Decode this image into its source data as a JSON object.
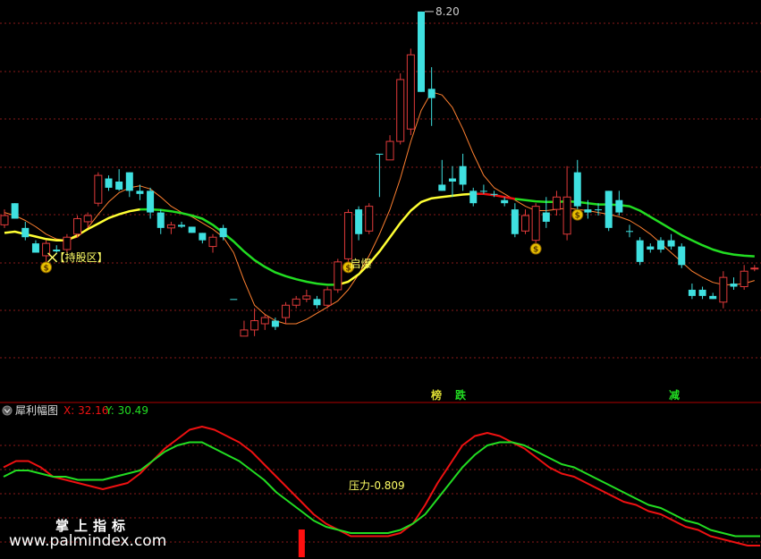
{
  "colors": {
    "background": "#000000",
    "grid": "#8a1a1a",
    "separator": "#b00000",
    "up_candle": "#e03a3a",
    "down_candle": "#3fe0e0",
    "ma_thin": "#ff8030",
    "ma_yellow": "#ffff33",
    "ma_green": "#22dd22",
    "ma_red": "#ee1111",
    "osc_red": "#ee1111",
    "osc_green": "#22dd22",
    "label_yellow": "#ffff66",
    "signal_gold": "#e8c000",
    "watermark": "#ffffff"
  },
  "main_chart": {
    "max_price_label": "8.20",
    "signal_labels": {
      "hold_zone": "【持股区】",
      "burst": "启爆",
      "top": "榜",
      "fall": "跌",
      "reduce": "减"
    },
    "money_icon_glyph": "$"
  },
  "sub_chart": {
    "indicator_name": "犀利幅图",
    "x_readout": "X: 32.16",
    "y_readout": "Y: 30.49",
    "pressure_label": "压力-0.809"
  },
  "watermark": {
    "cn": "掌上指标",
    "url": "www.palmindex.com"
  },
  "chart_data": [
    {
      "type": "candlestick",
      "title": "",
      "xlabel": "",
      "ylabel": "",
      "ylim": [
        2.6,
        8.3
      ],
      "grid": true,
      "max_label_value": 8.2,
      "candles": [
        {
          "o": 4.9,
          "h": 5.0,
          "l": 4.7,
          "c": 4.75,
          "dir": "up"
        },
        {
          "o": 5.1,
          "h": 5.1,
          "l": 4.85,
          "c": 4.85,
          "dir": "down"
        },
        {
          "o": 4.7,
          "h": 4.8,
          "l": 4.5,
          "c": 4.55,
          "dir": "down"
        },
        {
          "o": 4.45,
          "h": 4.5,
          "l": 4.3,
          "c": 4.3,
          "dir": "down"
        },
        {
          "o": 4.25,
          "h": 4.5,
          "l": 4.15,
          "c": 4.45,
          "dir": "up"
        },
        {
          "o": 4.35,
          "h": 4.42,
          "l": 4.3,
          "c": 4.32,
          "dir": "down"
        },
        {
          "o": 4.35,
          "h": 4.6,
          "l": 4.3,
          "c": 4.55,
          "dir": "up"
        },
        {
          "o": 4.6,
          "h": 4.9,
          "l": 4.55,
          "c": 4.85,
          "dir": "up"
        },
        {
          "o": 4.8,
          "h": 4.95,
          "l": 4.7,
          "c": 4.9,
          "dir": "up"
        },
        {
          "o": 5.1,
          "h": 5.6,
          "l": 5.05,
          "c": 5.55,
          "dir": "up"
        },
        {
          "o": 5.5,
          "h": 5.55,
          "l": 5.3,
          "c": 5.35,
          "dir": "down"
        },
        {
          "o": 5.45,
          "h": 5.65,
          "l": 5.3,
          "c": 5.32,
          "dir": "down"
        },
        {
          "o": 5.6,
          "h": 5.6,
          "l": 5.2,
          "c": 5.3,
          "dir": "down"
        },
        {
          "o": 5.3,
          "h": 5.4,
          "l": 5.15,
          "c": 5.25,
          "dir": "down"
        },
        {
          "o": 5.3,
          "h": 5.35,
          "l": 4.85,
          "c": 4.95,
          "dir": "down"
        },
        {
          "o": 4.95,
          "h": 5.0,
          "l": 4.6,
          "c": 4.7,
          "dir": "down"
        },
        {
          "o": 4.7,
          "h": 4.8,
          "l": 4.6,
          "c": 4.75,
          "dir": "up"
        },
        {
          "o": 4.75,
          "h": 4.8,
          "l": 4.7,
          "c": 4.72,
          "dir": "down"
        },
        {
          "o": 4.72,
          "h": 4.72,
          "l": 4.62,
          "c": 4.62,
          "dir": "down"
        },
        {
          "o": 4.62,
          "h": 4.62,
          "l": 4.45,
          "c": 4.5,
          "dir": "down"
        },
        {
          "o": 4.4,
          "h": 4.6,
          "l": 4.3,
          "c": 4.55,
          "dir": "up"
        },
        {
          "o": 4.7,
          "h": 4.75,
          "l": 4.5,
          "c": 4.55,
          "dir": "down"
        },
        {
          "o": 3.55,
          "h": 3.55,
          "l": 3.55,
          "c": 3.55,
          "dir": "down"
        },
        {
          "o": 2.95,
          "h": 3.2,
          "l": 2.95,
          "c": 3.05,
          "dir": "up"
        },
        {
          "o": 3.05,
          "h": 3.4,
          "l": 2.95,
          "c": 3.2,
          "dir": "up"
        },
        {
          "o": 3.15,
          "h": 3.3,
          "l": 3.05,
          "c": 3.25,
          "dir": "up"
        },
        {
          "o": 3.2,
          "h": 3.25,
          "l": 3.05,
          "c": 3.1,
          "dir": "down"
        },
        {
          "o": 3.25,
          "h": 3.5,
          "l": 3.15,
          "c": 3.45,
          "dir": "up"
        },
        {
          "o": 3.45,
          "h": 3.6,
          "l": 3.4,
          "c": 3.55,
          "dir": "up"
        },
        {
          "o": 3.55,
          "h": 3.7,
          "l": 3.5,
          "c": 3.6,
          "dir": "up"
        },
        {
          "o": 3.55,
          "h": 3.6,
          "l": 3.4,
          "c": 3.45,
          "dir": "down"
        },
        {
          "o": 3.45,
          "h": 3.75,
          "l": 3.4,
          "c": 3.7,
          "dir": "up"
        },
        {
          "o": 3.7,
          "h": 4.2,
          "l": 3.65,
          "c": 4.15,
          "dir": "up"
        },
        {
          "o": 4.2,
          "h": 5.0,
          "l": 4.15,
          "c": 4.95,
          "dir": "up"
        },
        {
          "o": 5.0,
          "h": 5.05,
          "l": 4.5,
          "c": 4.6,
          "dir": "down"
        },
        {
          "o": 4.65,
          "h": 5.1,
          "l": 4.6,
          "c": 5.05,
          "dir": "up"
        },
        {
          "o": 5.9,
          "h": 5.9,
          "l": 5.2,
          "c": 5.9,
          "dir": "down"
        },
        {
          "o": 5.8,
          "h": 6.2,
          "l": 5.8,
          "c": 6.1,
          "dir": "up"
        },
        {
          "o": 6.1,
          "h": 7.2,
          "l": 6.05,
          "c": 7.1,
          "dir": "up"
        },
        {
          "o": 6.3,
          "h": 7.6,
          "l": 6.2,
          "c": 7.5,
          "dir": "up"
        },
        {
          "o": 8.2,
          "h": 8.2,
          "l": 6.9,
          "c": 6.9,
          "dir": "down"
        },
        {
          "o": 6.95,
          "h": 7.3,
          "l": 6.35,
          "c": 6.8,
          "dir": "down"
        },
        {
          "o": 5.4,
          "h": 5.8,
          "l": 5.3,
          "c": 5.3,
          "dir": "down"
        },
        {
          "o": 5.45,
          "h": 5.7,
          "l": 5.2,
          "c": 5.5,
          "dir": "down"
        },
        {
          "o": 5.7,
          "h": 5.9,
          "l": 5.3,
          "c": 5.4,
          "dir": "down"
        },
        {
          "o": 5.3,
          "h": 5.35,
          "l": 5.05,
          "c": 5.1,
          "dir": "down"
        },
        {
          "o": 5.3,
          "h": 5.4,
          "l": 5.25,
          "c": 5.3,
          "dir": "down"
        },
        {
          "o": 5.25,
          "h": 5.3,
          "l": 5.2,
          "c": 5.25,
          "dir": "down"
        },
        {
          "o": 5.15,
          "h": 5.2,
          "l": 5.05,
          "c": 5.1,
          "dir": "down"
        },
        {
          "o": 5.0,
          "h": 5.1,
          "l": 4.55,
          "c": 4.6,
          "dir": "down"
        },
        {
          "o": 4.65,
          "h": 5.0,
          "l": 4.6,
          "c": 4.9,
          "dir": "up"
        },
        {
          "o": 4.5,
          "h": 5.1,
          "l": 4.45,
          "c": 5.05,
          "dir": "up"
        },
        {
          "o": 4.95,
          "h": 5.2,
          "l": 4.7,
          "c": 4.8,
          "dir": "down"
        },
        {
          "o": 5.0,
          "h": 5.3,
          "l": 4.9,
          "c": 5.2,
          "dir": "up"
        },
        {
          "o": 5.2,
          "h": 5.7,
          "l": 4.5,
          "c": 4.6,
          "dir": "up"
        },
        {
          "o": 5.6,
          "h": 5.8,
          "l": 5.0,
          "c": 5.05,
          "dir": "down"
        },
        {
          "o": 5.0,
          "h": 5.15,
          "l": 4.85,
          "c": 4.95,
          "dir": "down"
        },
        {
          "o": 5.0,
          "h": 5.1,
          "l": 4.9,
          "c": 5.0,
          "dir": "down"
        },
        {
          "o": 5.3,
          "h": 5.3,
          "l": 4.65,
          "c": 4.7,
          "dir": "down"
        },
        {
          "o": 5.15,
          "h": 5.3,
          "l": 4.9,
          "c": 4.95,
          "dir": "down"
        },
        {
          "o": 4.65,
          "h": 4.75,
          "l": 4.55,
          "c": 4.65,
          "dir": "down"
        },
        {
          "o": 4.5,
          "h": 4.55,
          "l": 4.1,
          "c": 4.15,
          "dir": "down"
        },
        {
          "o": 4.35,
          "h": 4.45,
          "l": 4.3,
          "c": 4.4,
          "dir": "down"
        },
        {
          "o": 4.5,
          "h": 4.55,
          "l": 4.3,
          "c": 4.35,
          "dir": "down"
        },
        {
          "o": 4.5,
          "h": 4.6,
          "l": 4.35,
          "c": 4.4,
          "dir": "down"
        },
        {
          "o": 4.4,
          "h": 4.45,
          "l": 4.05,
          "c": 4.1,
          "dir": "down"
        },
        {
          "o": 3.7,
          "h": 3.8,
          "l": 3.55,
          "c": 3.6,
          "dir": "down"
        },
        {
          "o": 3.7,
          "h": 3.75,
          "l": 3.55,
          "c": 3.6,
          "dir": "down"
        },
        {
          "o": 3.55,
          "h": 3.65,
          "l": 3.55,
          "c": 3.6,
          "dir": "down"
        },
        {
          "o": 3.5,
          "h": 4.0,
          "l": 3.4,
          "c": 3.9,
          "dir": "up"
        },
        {
          "o": 3.8,
          "h": 3.9,
          "l": 3.7,
          "c": 3.75,
          "dir": "down"
        },
        {
          "o": 3.75,
          "h": 4.1,
          "l": 3.7,
          "c": 4.0,
          "dir": "up"
        },
        {
          "o": 4.05,
          "h": 4.1,
          "l": 4.0,
          "c": 4.05,
          "dir": "up"
        }
      ],
      "ma_thin": [
        4.95,
        4.9,
        4.82,
        4.72,
        4.6,
        4.52,
        4.5,
        4.55,
        4.7,
        4.92,
        5.12,
        5.27,
        5.35,
        5.38,
        5.33,
        5.2,
        5.05,
        4.95,
        4.88,
        4.78,
        4.68,
        4.55,
        4.3,
        3.85,
        3.45,
        3.3,
        3.2,
        3.15,
        3.15,
        3.22,
        3.32,
        3.42,
        3.52,
        3.7,
        3.95,
        4.25,
        4.6,
        5.0,
        5.5,
        6.1,
        6.6,
        6.9,
        6.85,
        6.65,
        6.3,
        5.9,
        5.55,
        5.35,
        5.25,
        5.15,
        5.05,
        4.98,
        4.98,
        5.0,
        5.02,
        5.0,
        4.98,
        4.95,
        4.92,
        4.88,
        4.82,
        4.72,
        4.6,
        4.45,
        4.3,
        4.15,
        4.0,
        3.9,
        3.82,
        3.78,
        3.78,
        3.8,
        3.85
      ],
      "ma_main": [
        4.62,
        4.64,
        4.6,
        4.56,
        4.52,
        4.5,
        4.5,
        4.58,
        4.68,
        4.77,
        4.86,
        4.92,
        4.97,
        5.0,
        5.0,
        4.99,
        4.97,
        4.94,
        4.9,
        4.85,
        4.75,
        4.62,
        4.48,
        4.32,
        4.18,
        4.07,
        3.98,
        3.92,
        3.87,
        3.83,
        3.8,
        3.78,
        3.78,
        3.83,
        3.95,
        4.12,
        4.32,
        4.55,
        4.78,
        4.98,
        5.12,
        5.18,
        5.2,
        5.22,
        5.24,
        5.25,
        5.25,
        5.23,
        5.2,
        5.17,
        5.15,
        5.13,
        5.12,
        5.12,
        5.13,
        5.12,
        5.1,
        5.08,
        5.08,
        5.07,
        5.05,
        4.98,
        4.88,
        4.78,
        4.68,
        4.58,
        4.5,
        4.42,
        4.35,
        4.3,
        4.27,
        4.25,
        4.24
      ],
      "ma_main_color_runs": [
        {
          "from": 0,
          "to": 13,
          "color": "yellow"
        },
        {
          "from": 13,
          "to": 32,
          "color": "green"
        },
        {
          "from": 32,
          "to": 45,
          "color": "yellow"
        },
        {
          "from": 45,
          "to": 49,
          "color": "red"
        },
        {
          "from": 49,
          "to": 72,
          "color": "green"
        }
      ],
      "signals": [
        {
          "index": 4,
          "kind": "money",
          "label": "hold_zone"
        },
        {
          "index": 33,
          "kind": "money",
          "label": "burst"
        },
        {
          "index": 51,
          "kind": "money",
          "label": ""
        },
        {
          "index": 55,
          "kind": "money",
          "label": ""
        },
        {
          "index": 39,
          "kind": "text",
          "label": "top"
        },
        {
          "index": 42,
          "kind": "text",
          "label": "fall"
        },
        {
          "index": 61,
          "kind": "text",
          "label": "reduce"
        }
      ]
    },
    {
      "type": "line",
      "title": "",
      "xlabel": "",
      "ylabel": "",
      "ylim": [
        20,
        60
      ],
      "grid": true,
      "series": [
        {
          "values": [
            45,
            47,
            47,
            45,
            42,
            41,
            40,
            39,
            38,
            39,
            40,
            43,
            47,
            51,
            54,
            57,
            58,
            57,
            55,
            53,
            50,
            46,
            42,
            38,
            34,
            30,
            27,
            25,
            23,
            23,
            23,
            23,
            24,
            27,
            33,
            40,
            46,
            52,
            55,
            56,
            55,
            53,
            51,
            48,
            45,
            43,
            42,
            40,
            38,
            36,
            34,
            33,
            31,
            30,
            28,
            26,
            25,
            23,
            22,
            21,
            20,
            20
          ]
        },
        {
          "values": [
            42,
            44,
            44,
            43,
            42,
            42,
            41,
            41,
            41,
            42,
            43,
            44,
            47,
            50,
            52,
            53,
            53,
            51,
            49,
            47,
            44,
            41,
            37,
            34,
            31,
            28,
            26,
            25,
            24,
            24,
            24,
            24,
            25,
            27,
            30,
            35,
            40,
            45,
            49,
            52,
            53,
            53,
            52,
            50,
            48,
            46,
            45,
            43,
            41,
            39,
            37,
            35,
            33,
            32,
            30,
            28,
            27,
            25,
            24,
            23,
            23,
            23
          ]
        }
      ],
      "annotations": [
        "压力-0.809"
      ],
      "signal_bar_index": 24
    }
  ]
}
